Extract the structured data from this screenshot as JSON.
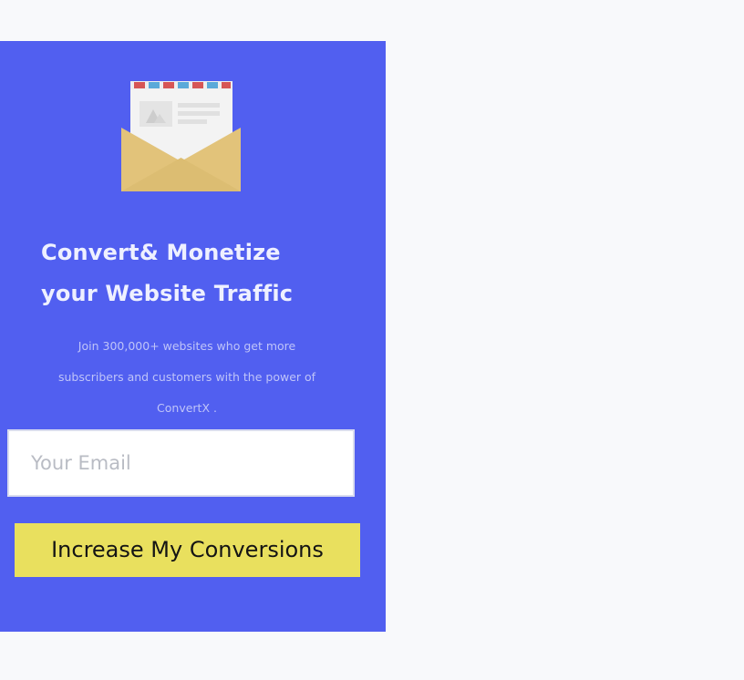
{
  "hero": {
    "icon": "open-envelope-icon",
    "headline_line1": "Convert& Monetize",
    "headline_line2": "your Website Traffic",
    "description": "Join 300,000+ websites who get more subscribers and customers with the power of ConvertX ."
  },
  "form": {
    "email_placeholder": "Your Email",
    "email_value": "",
    "submit_label": "Increase My Conversions"
  },
  "colors": {
    "page_background": "#f8f9fb",
    "panel_background": "#515ff0",
    "button_background": "#e9e05e",
    "headline_text": "#eef0ff"
  }
}
